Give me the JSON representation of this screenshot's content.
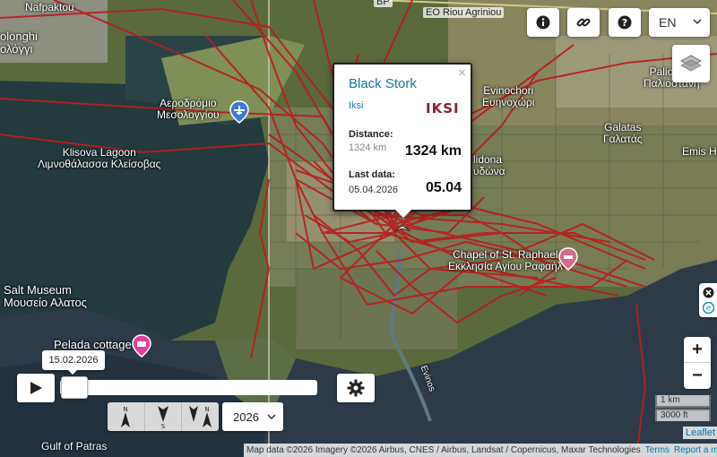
{
  "map": {
    "places": [
      {
        "id": "nafpaktos",
        "lines": [
          "Nafpaktou"
        ]
      },
      {
        "id": "mesolonghi",
        "lines": [
          "olonghi",
          "ολόγγι"
        ]
      },
      {
        "id": "airport",
        "lines": [
          "Αεροδρόμιο",
          "Μεσολογγίου"
        ]
      },
      {
        "id": "klisova",
        "lines": [
          "Klisova Lagoon",
          "Λιμνοθάλασσα Κλείσοβας"
        ]
      },
      {
        "id": "evinochori",
        "lines": [
          "Evinochori",
          "Ευηνοχώρι"
        ]
      },
      {
        "id": "paliostani",
        "lines": [
          "Paliostan",
          "Παλιόστανη"
        ]
      },
      {
        "id": "galatas",
        "lines": [
          "Galatas",
          "Γαλατάς"
        ]
      },
      {
        "id": "emis",
        "lines": [
          "Emis H"
        ]
      },
      {
        "id": "lidona",
        "lines": [
          "lidona",
          "υδώνα"
        ]
      },
      {
        "id": "chapel",
        "lines": [
          "Chapel of St. Raphael",
          "Εκκλησία Αγίου Ραφαήλ"
        ]
      },
      {
        "id": "salt-museum",
        "lines": [
          "Salt Museum",
          "Μουσείο Αλατος"
        ]
      },
      {
        "id": "pelada",
        "lines": [
          "Pelada cottage"
        ]
      },
      {
        "id": "gulf",
        "lines": [
          "Gulf of Patras"
        ]
      },
      {
        "id": "evinos",
        "lines": [
          "Evinos"
        ]
      }
    ],
    "road_label": "EO Riou Agriniou",
    "road_prefix": "BP"
  },
  "toolbar": {
    "info_icon": "info-icon",
    "link_icon": "link-icon",
    "help_icon": "help-icon",
    "language": "EN",
    "layers_icon": "layers-icon"
  },
  "popup": {
    "species": "Black Stork",
    "organization": "Iksi",
    "logo_text": "IKSI",
    "distance_label": "Distance:",
    "distance_small": "1324 km",
    "distance_value": "1324 km",
    "last_data_label": "Last data:",
    "last_data_small": "05.04.2026",
    "last_data_value": "05.04",
    "close": "×"
  },
  "playback": {
    "current_date": "15.02.2026",
    "progress": 0.0,
    "year": "2026",
    "direction_labels": [
      "N",
      "S",
      "N"
    ]
  },
  "zoom": {
    "in": "+",
    "out": "−"
  },
  "scale": {
    "metric": "1 km",
    "imperial": "3000 ft"
  },
  "attribution": {
    "text": "Map data ©2026 Imagery ©2026 Airbus, CNES / Airbus, Landsat / Copernicus, Maxar Technologies",
    "terms": "Terms",
    "report": "Report a map error",
    "leaflet": "Leaflet"
  },
  "colors": {
    "track": "#b81e1e",
    "accent": "#1976a8",
    "logo": "#8c1d2d"
  }
}
